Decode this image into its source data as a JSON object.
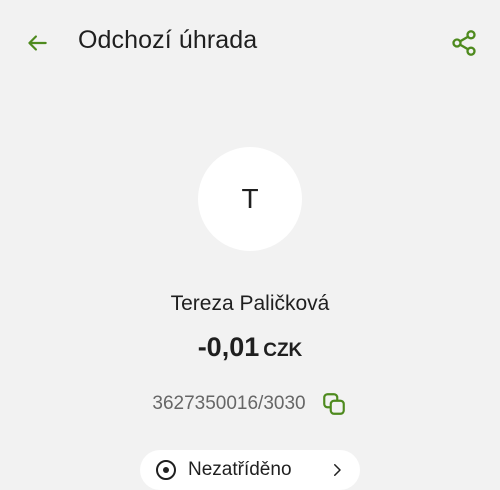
{
  "header": {
    "title": "Odchozí úhrada",
    "back_icon": "arrow-left-icon",
    "share_icon": "share-icon"
  },
  "colors": {
    "accent": "#4e8a1e",
    "background": "#f2f2f2"
  },
  "counterparty": {
    "initial": "T",
    "name": "Tereza Paličková"
  },
  "transaction": {
    "amount": "-0,01",
    "currency": "CZK"
  },
  "account": {
    "number": "3627350016/3030",
    "copy_icon": "copy-icon"
  },
  "category_chip": {
    "label": "Nezatříděno",
    "icon": "category-icon"
  }
}
